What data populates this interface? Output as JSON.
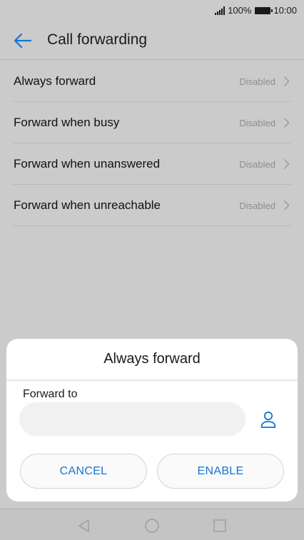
{
  "status_bar": {
    "battery": "100%",
    "time": "10:00"
  },
  "header": {
    "title": "Call forwarding"
  },
  "list": [
    {
      "label": "Always forward",
      "value": "Disabled"
    },
    {
      "label": "Forward when busy",
      "value": "Disabled"
    },
    {
      "label": "Forward when unanswered",
      "value": "Disabled"
    },
    {
      "label": "Forward when unreachable",
      "value": "Disabled"
    }
  ],
  "dialog": {
    "title": "Always forward",
    "field_label": "Forward to",
    "field_value": "",
    "cancel_label": "CANCEL",
    "enable_label": "ENABLE"
  },
  "colors": {
    "accent": "#1475d6",
    "scrim_background": "#cbcbcb",
    "dialog_background": "#ffffff"
  },
  "icons": [
    "signal-icon",
    "battery-icon",
    "back-arrow-icon",
    "chevron-right-icon",
    "contact-icon",
    "nav-back-icon",
    "nav-home-icon",
    "nav-recents-icon"
  ]
}
